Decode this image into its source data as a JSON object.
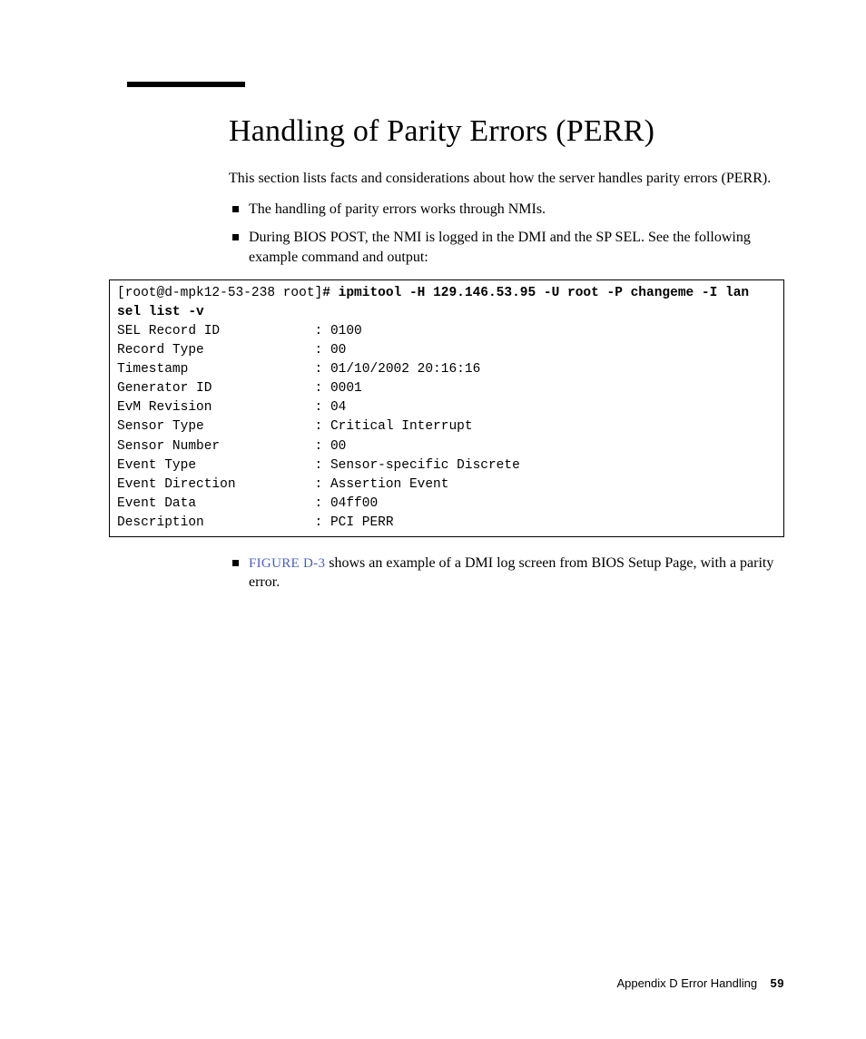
{
  "title": "Handling of Parity Errors (PERR)",
  "intro": "This section lists facts and considerations about how the server handles parity errors (PERR).",
  "bullets": {
    "b1": "The handling of parity errors works through NMIs.",
    "b2": "During BIOS POST, the NMI is logged in the DMI and the SP SEL. See the following example command and output:"
  },
  "code": {
    "prompt": "[root@d-mpk12-53-238 root]",
    "cmd1": "# ipmitool -H 129.146.53.95 -U root -P changeme -I lan",
    "cmd2": "sel list -v",
    "lines": [
      "SEL Record ID            : 0100",
      "Record Type              : 00",
      "Timestamp                : 01/10/2002 20:16:16",
      "Generator ID             : 0001",
      "EvM Revision             : 04",
      "Sensor Type              : Critical Interrupt",
      "Sensor Number            : 00",
      "Event Type               : Sensor-specific Discrete",
      "Event Direction          : Assertion Event",
      "Event Data               : 04ff00",
      "Description              : PCI PERR"
    ]
  },
  "bullets2": {
    "ref": "FIGURE D-3",
    "rest": " shows an example of a DMI log screen from BIOS Setup Page, with a parity error."
  },
  "footer": {
    "left": "Appendix D    Error Handling",
    "page": "59"
  }
}
